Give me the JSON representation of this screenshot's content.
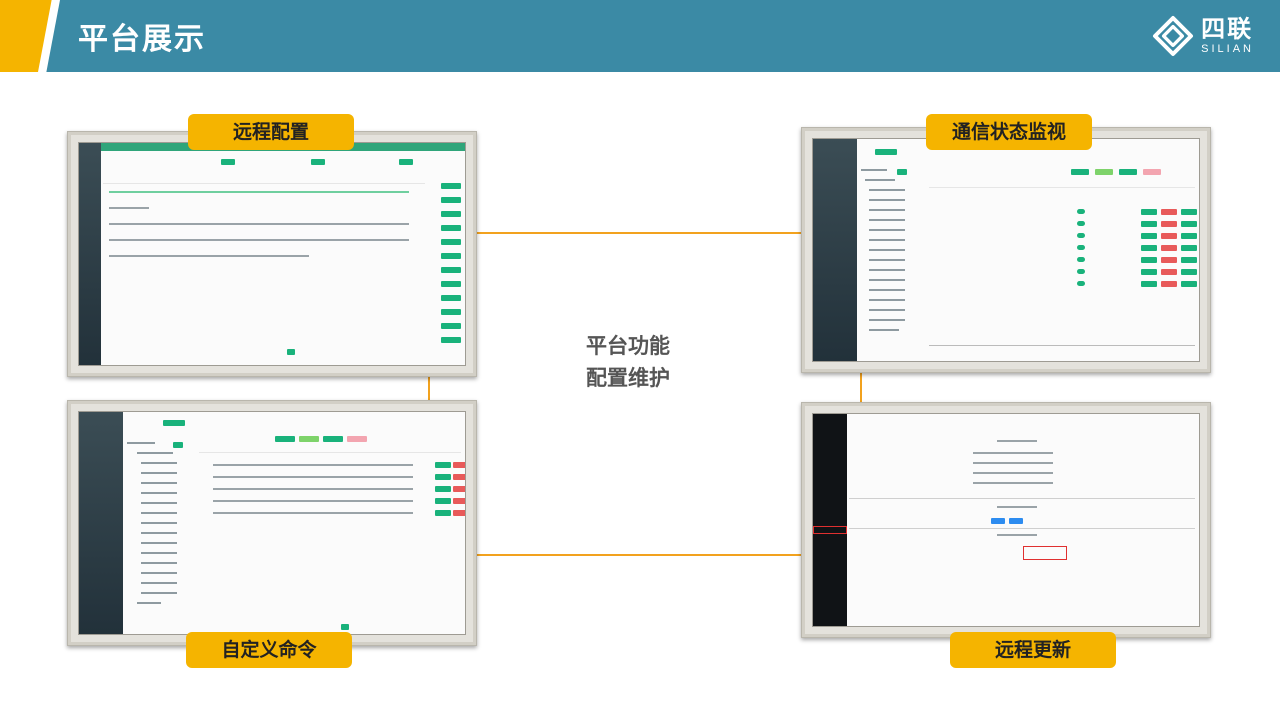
{
  "header": {
    "title": "平台展示"
  },
  "logo": {
    "cn": "四联",
    "en": "SILIAN"
  },
  "center": {
    "line1": "平台功能",
    "line2": "配置维护"
  },
  "panels": [
    {
      "label": "远程配置"
    },
    {
      "label": "通信状态监视"
    },
    {
      "label": "自定义命令"
    },
    {
      "label": "远程更新"
    }
  ],
  "colors": {
    "header": "#3b8aa5",
    "accent": "#f5b400",
    "connector": "#f2a21e",
    "green": "#19b27b",
    "red": "#e85a5a"
  },
  "icons": [
    "logo-mark-icon"
  ]
}
